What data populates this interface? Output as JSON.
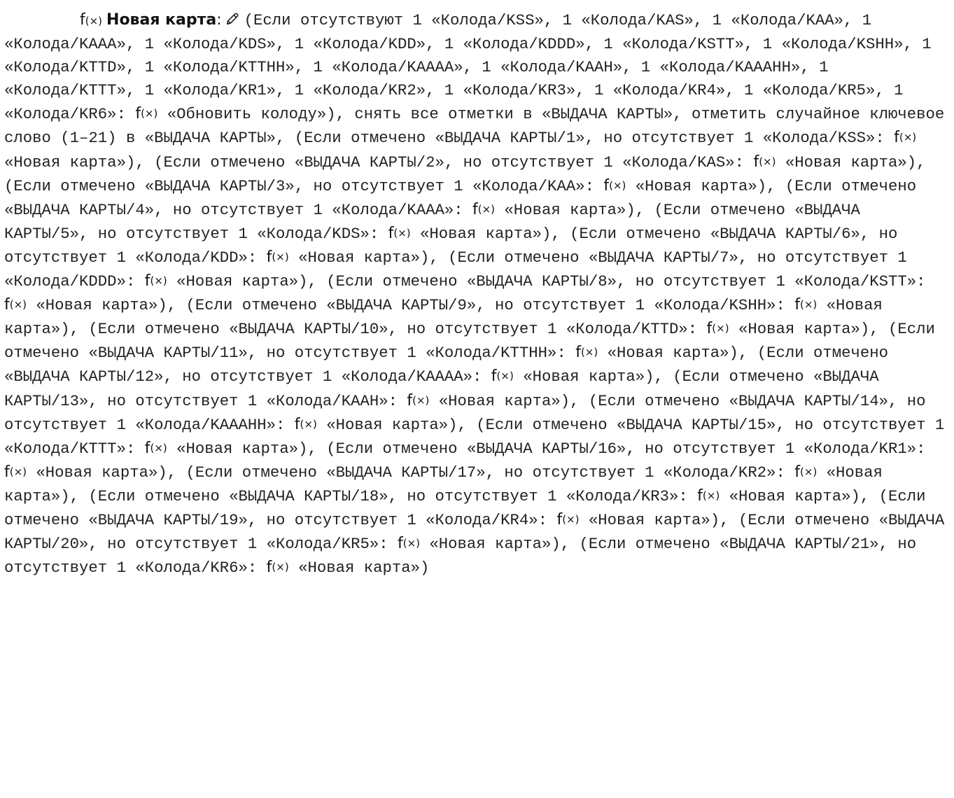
{
  "function": {
    "fx_label": "f(×)",
    "title": "Новая карта",
    "colon": ":",
    "edit_icon": "pencil-icon"
  },
  "segments": [
    {
      "type": "text",
      "value": "(Если отсутствуют 1 «Колода/KSS», 1 «Колода/KAS», 1 «Колода/KAA», 1 «Колода/KAAA», 1 «Колода/KDS», 1 «Колода/KDD», 1 «Колода/KDDD», 1 «Колода/KSTT», 1 «Колода/KSHH», 1 «Колода/KTTD», 1 «Колода/KTTHH», 1 «Колода/KAAAA», 1 «Колода/KAAH», 1 «Колода/KAAAHH», 1 «Колода/KTTT», 1 «Колода/KR1», 1 «Колода/KR2», 1 «Колода/KR3», 1 «Колода/KR4», 1 «Колода/KR5», 1 «Колода/KR6»: "
    },
    {
      "type": "call",
      "value": "f(×)"
    },
    {
      "type": "text",
      "value": " «Обновить колоду»), снять все отметки в «ВЫДАЧА КАРТЫ», отметить случайное ключевое слово (1–21) в «ВЫДАЧА КАРТЫ», (Если отмечено «ВЫДАЧА КАРТЫ/1», но отсутствует 1 «Колода/KSS»: "
    },
    {
      "type": "call",
      "value": "f(×)"
    },
    {
      "type": "text",
      "value": " «Новая карта»), (Если отмечено «ВЫДАЧА КАРТЫ/2», но отсутствует 1 «Колода/KAS»: "
    },
    {
      "type": "call",
      "value": "f(×)"
    },
    {
      "type": "text",
      "value": " «Новая карта»), (Если отмечено «ВЫДАЧА КАРТЫ/3», но отсутствует 1 «Колода/KAA»: "
    },
    {
      "type": "call",
      "value": "f(×)"
    },
    {
      "type": "text",
      "value": " «Новая карта»), (Если отмечено «ВЫДАЧА КАРТЫ/4», но отсутствует 1 «Колода/KAAA»: "
    },
    {
      "type": "call",
      "value": "f(×)"
    },
    {
      "type": "text",
      "value": " «Новая карта»), (Если отмечено «ВЫДАЧА КАРТЫ/5», но отсутствует 1 «Колода/KDS»: "
    },
    {
      "type": "call",
      "value": "f(×)"
    },
    {
      "type": "text",
      "value": " «Новая карта»), (Если отмечено «ВЫДАЧА КАРТЫ/6», но отсутствует 1 «Колода/KDD»: "
    },
    {
      "type": "call",
      "value": "f(×)"
    },
    {
      "type": "text",
      "value": " «Новая карта»), (Если отмечено «ВЫДАЧА КАРТЫ/7», но отсутствует 1 «Колода/KDDD»: "
    },
    {
      "type": "call",
      "value": "f(×)"
    },
    {
      "type": "text",
      "value": " «Новая карта»), (Если отмечено «ВЫДАЧА КАРТЫ/8», но отсутствует 1 «Колода/KSTT»: "
    },
    {
      "type": "call",
      "value": "f(×)"
    },
    {
      "type": "text",
      "value": " «Новая карта»), (Если отмечено «ВЫДАЧА КАРТЫ/9», но отсутствует 1 «Колода/KSHH»: "
    },
    {
      "type": "call",
      "value": "f(×)"
    },
    {
      "type": "text",
      "value": " «Новая карта»), (Если отмечено «ВЫДАЧА КАРТЫ/10», но отсутствует 1 «Колода/KTTD»: "
    },
    {
      "type": "call",
      "value": "f(×)"
    },
    {
      "type": "text",
      "value": " «Новая карта»), (Если отмечено «ВЫДАЧА КАРТЫ/11», но отсутствует 1 «Колода/KTTHH»: "
    },
    {
      "type": "call",
      "value": "f(×)"
    },
    {
      "type": "text",
      "value": " «Новая карта»), (Если отмечено «ВЫДАЧА КАРТЫ/12», но отсутствует 1 «Колода/KAAAA»: "
    },
    {
      "type": "call",
      "value": "f(×)"
    },
    {
      "type": "text",
      "value": " «Новая карта»), (Если отмечено «ВЫДАЧА КАРТЫ/13», но отсутствует 1 «Колода/KAAH»: "
    },
    {
      "type": "call",
      "value": "f(×)"
    },
    {
      "type": "text",
      "value": " «Новая карта»), (Если отмечено «ВЫДАЧА КАРТЫ/14», но отсутствует 1 «Колода/KAAAHH»: "
    },
    {
      "type": "call",
      "value": "f(×)"
    },
    {
      "type": "text",
      "value": " «Новая карта»), (Если отмечено «ВЫДАЧА КАРТЫ/15», но отсутствует 1 «Колода/KTTT»: "
    },
    {
      "type": "call",
      "value": "f(×)"
    },
    {
      "type": "text",
      "value": " «Новая карта»), (Если отмечено «ВЫДАЧА КАРТЫ/16», но отсутствует 1 «Колода/KR1»: "
    },
    {
      "type": "call",
      "value": "f(×)"
    },
    {
      "type": "text",
      "value": " «Новая карта»), (Если отмечено «ВЫДАЧА КАРТЫ/17», но отсутствует 1 «Колода/KR2»: "
    },
    {
      "type": "call",
      "value": "f(×)"
    },
    {
      "type": "text",
      "value": " «Новая карта»), (Если отмечено «ВЫДАЧА КАРТЫ/18», но отсутствует 1 «Колода/KR3»: "
    },
    {
      "type": "call",
      "value": "f(×)"
    },
    {
      "type": "text",
      "value": " «Новая карта»), (Если отмечено «ВЫДАЧА КАРТЫ/19», но отсутствует 1 «Колода/KR4»: "
    },
    {
      "type": "call",
      "value": "f(×)"
    },
    {
      "type": "text",
      "value": " «Новая карта»), (Если отмечено «ВЫДАЧА КАРТЫ/20», но отсутствует 1 «Колода/KR5»: "
    },
    {
      "type": "call",
      "value": "f(×)"
    },
    {
      "type": "text",
      "value": " «Новая карта»), (Если отмечено «ВЫДАЧА КАРТЫ/21», но отсутствует 1 «Колода/KR6»: "
    },
    {
      "type": "call",
      "value": "f(×)"
    },
    {
      "type": "text",
      "value": " «Новая карта»)"
    }
  ]
}
